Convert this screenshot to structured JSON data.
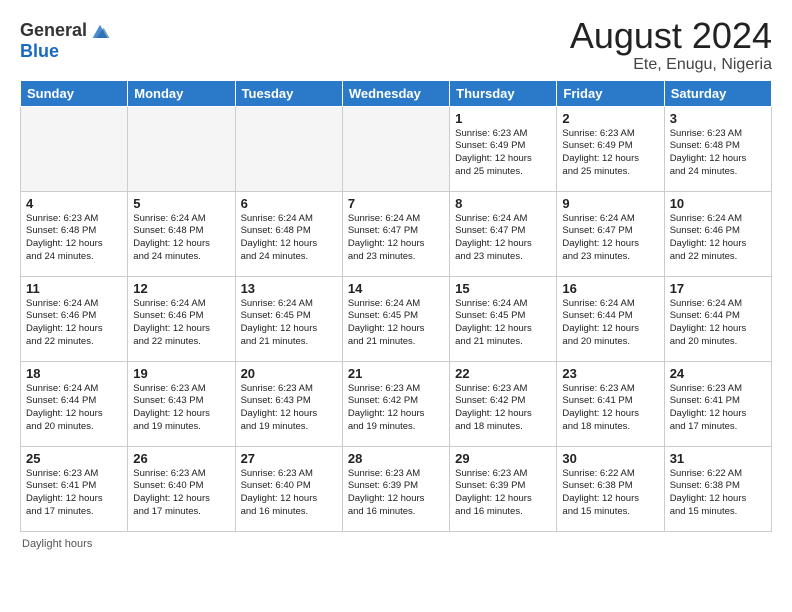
{
  "header": {
    "logo_general": "General",
    "logo_blue": "Blue",
    "month": "August 2024",
    "location": "Ete, Enugu, Nigeria"
  },
  "weekdays": [
    "Sunday",
    "Monday",
    "Tuesday",
    "Wednesday",
    "Thursday",
    "Friday",
    "Saturday"
  ],
  "footer": {
    "daylight_label": "Daylight hours"
  },
  "weeks": [
    [
      {
        "day": "",
        "info": ""
      },
      {
        "day": "",
        "info": ""
      },
      {
        "day": "",
        "info": ""
      },
      {
        "day": "",
        "info": ""
      },
      {
        "day": "1",
        "info": "Sunrise: 6:23 AM\nSunset: 6:49 PM\nDaylight: 12 hours\nand 25 minutes."
      },
      {
        "day": "2",
        "info": "Sunrise: 6:23 AM\nSunset: 6:49 PM\nDaylight: 12 hours\nand 25 minutes."
      },
      {
        "day": "3",
        "info": "Sunrise: 6:23 AM\nSunset: 6:48 PM\nDaylight: 12 hours\nand 24 minutes."
      }
    ],
    [
      {
        "day": "4",
        "info": "Sunrise: 6:23 AM\nSunset: 6:48 PM\nDaylight: 12 hours\nand 24 minutes."
      },
      {
        "day": "5",
        "info": "Sunrise: 6:24 AM\nSunset: 6:48 PM\nDaylight: 12 hours\nand 24 minutes."
      },
      {
        "day": "6",
        "info": "Sunrise: 6:24 AM\nSunset: 6:48 PM\nDaylight: 12 hours\nand 24 minutes."
      },
      {
        "day": "7",
        "info": "Sunrise: 6:24 AM\nSunset: 6:47 PM\nDaylight: 12 hours\nand 23 minutes."
      },
      {
        "day": "8",
        "info": "Sunrise: 6:24 AM\nSunset: 6:47 PM\nDaylight: 12 hours\nand 23 minutes."
      },
      {
        "day": "9",
        "info": "Sunrise: 6:24 AM\nSunset: 6:47 PM\nDaylight: 12 hours\nand 23 minutes."
      },
      {
        "day": "10",
        "info": "Sunrise: 6:24 AM\nSunset: 6:46 PM\nDaylight: 12 hours\nand 22 minutes."
      }
    ],
    [
      {
        "day": "11",
        "info": "Sunrise: 6:24 AM\nSunset: 6:46 PM\nDaylight: 12 hours\nand 22 minutes."
      },
      {
        "day": "12",
        "info": "Sunrise: 6:24 AM\nSunset: 6:46 PM\nDaylight: 12 hours\nand 22 minutes."
      },
      {
        "day": "13",
        "info": "Sunrise: 6:24 AM\nSunset: 6:45 PM\nDaylight: 12 hours\nand 21 minutes."
      },
      {
        "day": "14",
        "info": "Sunrise: 6:24 AM\nSunset: 6:45 PM\nDaylight: 12 hours\nand 21 minutes."
      },
      {
        "day": "15",
        "info": "Sunrise: 6:24 AM\nSunset: 6:45 PM\nDaylight: 12 hours\nand 21 minutes."
      },
      {
        "day": "16",
        "info": "Sunrise: 6:24 AM\nSunset: 6:44 PM\nDaylight: 12 hours\nand 20 minutes."
      },
      {
        "day": "17",
        "info": "Sunrise: 6:24 AM\nSunset: 6:44 PM\nDaylight: 12 hours\nand 20 minutes."
      }
    ],
    [
      {
        "day": "18",
        "info": "Sunrise: 6:24 AM\nSunset: 6:44 PM\nDaylight: 12 hours\nand 20 minutes."
      },
      {
        "day": "19",
        "info": "Sunrise: 6:23 AM\nSunset: 6:43 PM\nDaylight: 12 hours\nand 19 minutes."
      },
      {
        "day": "20",
        "info": "Sunrise: 6:23 AM\nSunset: 6:43 PM\nDaylight: 12 hours\nand 19 minutes."
      },
      {
        "day": "21",
        "info": "Sunrise: 6:23 AM\nSunset: 6:42 PM\nDaylight: 12 hours\nand 19 minutes."
      },
      {
        "day": "22",
        "info": "Sunrise: 6:23 AM\nSunset: 6:42 PM\nDaylight: 12 hours\nand 18 minutes."
      },
      {
        "day": "23",
        "info": "Sunrise: 6:23 AM\nSunset: 6:41 PM\nDaylight: 12 hours\nand 18 minutes."
      },
      {
        "day": "24",
        "info": "Sunrise: 6:23 AM\nSunset: 6:41 PM\nDaylight: 12 hours\nand 17 minutes."
      }
    ],
    [
      {
        "day": "25",
        "info": "Sunrise: 6:23 AM\nSunset: 6:41 PM\nDaylight: 12 hours\nand 17 minutes."
      },
      {
        "day": "26",
        "info": "Sunrise: 6:23 AM\nSunset: 6:40 PM\nDaylight: 12 hours\nand 17 minutes."
      },
      {
        "day": "27",
        "info": "Sunrise: 6:23 AM\nSunset: 6:40 PM\nDaylight: 12 hours\nand 16 minutes."
      },
      {
        "day": "28",
        "info": "Sunrise: 6:23 AM\nSunset: 6:39 PM\nDaylight: 12 hours\nand 16 minutes."
      },
      {
        "day": "29",
        "info": "Sunrise: 6:23 AM\nSunset: 6:39 PM\nDaylight: 12 hours\nand 16 minutes."
      },
      {
        "day": "30",
        "info": "Sunrise: 6:22 AM\nSunset: 6:38 PM\nDaylight: 12 hours\nand 15 minutes."
      },
      {
        "day": "31",
        "info": "Sunrise: 6:22 AM\nSunset: 6:38 PM\nDaylight: 12 hours\nand 15 minutes."
      }
    ]
  ]
}
